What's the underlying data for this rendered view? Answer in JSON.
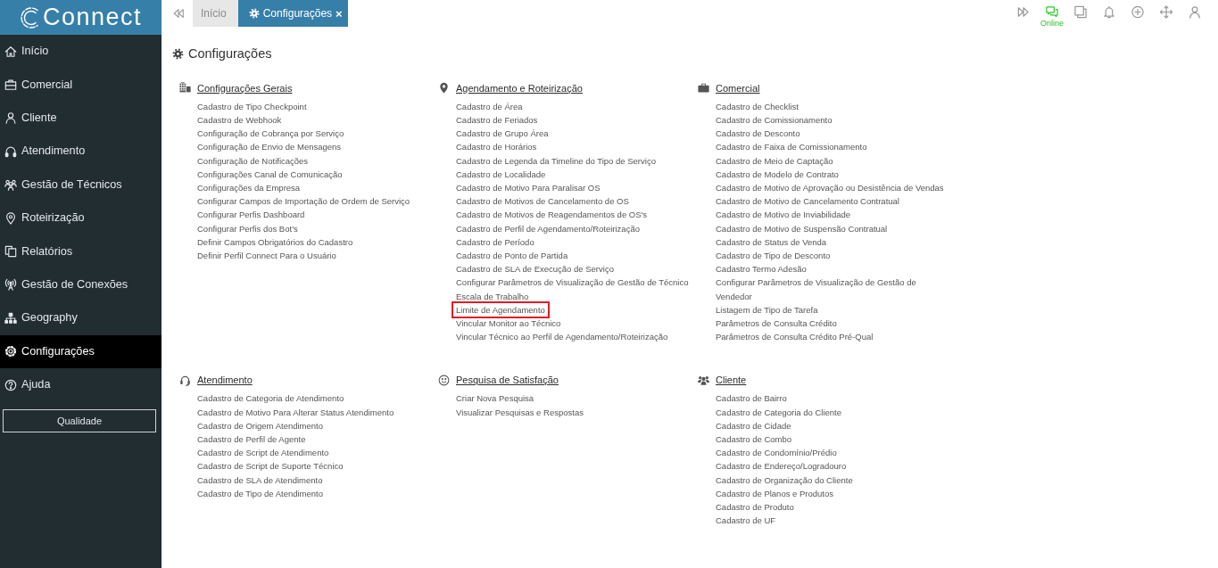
{
  "sidebar": {
    "logo": "Connect",
    "items": [
      {
        "label": "Início",
        "selected": false
      },
      {
        "label": "Comercial",
        "selected": false
      },
      {
        "label": "Cliente",
        "selected": false
      },
      {
        "label": "Atendimento",
        "selected": false
      },
      {
        "label": "Gestão de Técnicos",
        "selected": false
      },
      {
        "label": "Roteirização",
        "selected": false
      },
      {
        "label": "Relatórios",
        "selected": false
      },
      {
        "label": "Gestão de Conexões",
        "selected": false
      },
      {
        "label": "Geography",
        "selected": false
      },
      {
        "label": "Configurações",
        "selected": true
      },
      {
        "label": "Ajuda",
        "selected": false
      }
    ],
    "button": "Qualidade"
  },
  "topbar": {
    "tabs": [
      {
        "label": "Início",
        "selected": false
      },
      {
        "label": "Configurações",
        "selected": true,
        "close": "×"
      }
    ],
    "status": "Online"
  },
  "page": {
    "title": "Configurações",
    "sections": [
      {
        "title": "Configurações Gerais",
        "items": [
          {
            "label": "Cadastro de Tipo Checkpoint",
            "highlighted": false
          },
          {
            "label": "Cadastro de Webhook",
            "highlighted": false
          },
          {
            "label": "Configuração de Cobrança por Serviço",
            "highlighted": false
          },
          {
            "label": "Configuração de Envio de Mensagens",
            "highlighted": false
          },
          {
            "label": "Configuração de Notificações",
            "highlighted": false
          },
          {
            "label": "Configurações Canal de Comunicação",
            "highlighted": false
          },
          {
            "label": "Configurações da Empresa",
            "highlighted": false
          },
          {
            "label": "Configurar Campos de Importação de Ordem de Serviço",
            "highlighted": false
          },
          {
            "label": "Configurar Perfis Dashboard",
            "highlighted": false
          },
          {
            "label": "Configurar Perfis dos Bot's",
            "highlighted": false
          },
          {
            "label": "Definir Campos Obrigatórios do Cadastro",
            "highlighted": false
          },
          {
            "label": "Definir Perfil Connect Para o Usuário",
            "highlighted": false
          }
        ]
      },
      {
        "title": "Agendamento e Roteirização",
        "items": [
          {
            "label": "Cadastro de Área",
            "highlighted": false
          },
          {
            "label": "Cadastro de Feriados",
            "highlighted": false
          },
          {
            "label": "Cadastro de Grupo Área",
            "highlighted": false
          },
          {
            "label": "Cadastro de Horários",
            "highlighted": false
          },
          {
            "label": "Cadastro de Legenda da Timeline do Tipo de Serviço",
            "highlighted": false
          },
          {
            "label": "Cadastro de Localidade",
            "highlighted": false
          },
          {
            "label": "Cadastro de Motivo Para Paralisar OS",
            "highlighted": false
          },
          {
            "label": "Cadastro de Motivos de Cancelamento de OS",
            "highlighted": false
          },
          {
            "label": "Cadastro de Motivos de Reagendamentos de OS's",
            "highlighted": false
          },
          {
            "label": "Cadastro de Perfil de Agendamento/Roteirização",
            "highlighted": false
          },
          {
            "label": "Cadastro de Período",
            "highlighted": false
          },
          {
            "label": "Cadastro de Ponto de Partida",
            "highlighted": false
          },
          {
            "label": "Cadastro de SLA de Execução de Serviço",
            "highlighted": false
          },
          {
            "label": "Configurar Parâmetros de Visualização de Gestão de Técnico",
            "highlighted": false
          },
          {
            "label": "Escala de Trabalho",
            "highlighted": false
          },
          {
            "label": "Limite de Agendamento",
            "highlighted": true
          },
          {
            "label": "Vincular Monitor ao Técnico",
            "highlighted": false
          },
          {
            "label": "Vincular Técnico ao Perfil de Agendamento/Roteirização",
            "highlighted": false
          }
        ]
      },
      {
        "title": "Comercial",
        "items": [
          {
            "label": "Cadastro de Checklist",
            "highlighted": false
          },
          {
            "label": "Cadastro de Comissionamento",
            "highlighted": false
          },
          {
            "label": "Cadastro de Desconto",
            "highlighted": false
          },
          {
            "label": "Cadastro de Faixa de Comissionamento",
            "highlighted": false
          },
          {
            "label": "Cadastro de Meio de Captação",
            "highlighted": false
          },
          {
            "label": "Cadastro de Modelo de Contrato",
            "highlighted": false
          },
          {
            "label": "Cadastro de Motivo de Aprovação ou Desistência de Vendas",
            "highlighted": false
          },
          {
            "label": "Cadastro de Motivo de Cancelamento Contratual",
            "highlighted": false
          },
          {
            "label": "Cadastro de Motivo de Inviabilidade",
            "highlighted": false
          },
          {
            "label": "Cadastro de Motivo de Suspensão Contratual",
            "highlighted": false
          },
          {
            "label": "Cadastro de Status de Venda",
            "highlighted": false
          },
          {
            "label": "Cadastro de Tipo de Desconto",
            "highlighted": false
          },
          {
            "label": "Cadastro Termo Adesão",
            "highlighted": false
          },
          {
            "label": "Configurar Parâmetros de Visualização de Gestão de Vendedor",
            "highlighted": false
          },
          {
            "label": "Listagem de Tipo de Tarefa",
            "highlighted": false
          },
          {
            "label": "Parâmetros de Consulta Crédito",
            "highlighted": false
          },
          {
            "label": "Parâmetros de Consulta Crédito Pré-Qual",
            "highlighted": false
          }
        ]
      },
      {
        "title": "Atendimento",
        "items": [
          {
            "label": "Cadastro de Categoria de Atendimento",
            "highlighted": false
          },
          {
            "label": "Cadastro de Motivo Para Alterar Status Atendimento",
            "highlighted": false
          },
          {
            "label": "Cadastro de Origem Atendimento",
            "highlighted": false
          },
          {
            "label": "Cadastro de Perfil de Agente",
            "highlighted": false
          },
          {
            "label": "Cadastro de Script de Atendimento",
            "highlighted": false
          },
          {
            "label": "Cadastro de Script de Suporte Técnico",
            "highlighted": false
          },
          {
            "label": "Cadastro de SLA de Atendimento",
            "highlighted": false
          },
          {
            "label": "Cadastro de Tipo de Atendimento",
            "highlighted": false
          }
        ]
      },
      {
        "title": "Pesquisa de Satisfação",
        "items": [
          {
            "label": "Criar Nova Pesquisa",
            "highlighted": false
          },
          {
            "label": "Visualizar Pesquisas e Respostas",
            "highlighted": false
          }
        ]
      },
      {
        "title": "Cliente",
        "items": [
          {
            "label": "Cadastro de Bairro",
            "highlighted": false
          },
          {
            "label": "Cadastro de Categoria do Cliente",
            "highlighted": false
          },
          {
            "label": "Cadastro de Cidade",
            "highlighted": false
          },
          {
            "label": "Cadastro de Combo",
            "highlighted": false
          },
          {
            "label": "Cadastro de Condomínio/Prédio",
            "highlighted": false
          },
          {
            "label": "Cadastro de Endereço/Logradouro",
            "highlighted": false
          },
          {
            "label": "Cadastro de Organização do Cliente",
            "highlighted": false
          },
          {
            "label": "Cadastro de Planos e Produtos",
            "highlighted": false
          },
          {
            "label": "Cadastro de Produto",
            "highlighted": false
          },
          {
            "label": "Cadastro de UF",
            "highlighted": false
          }
        ]
      }
    ]
  }
}
